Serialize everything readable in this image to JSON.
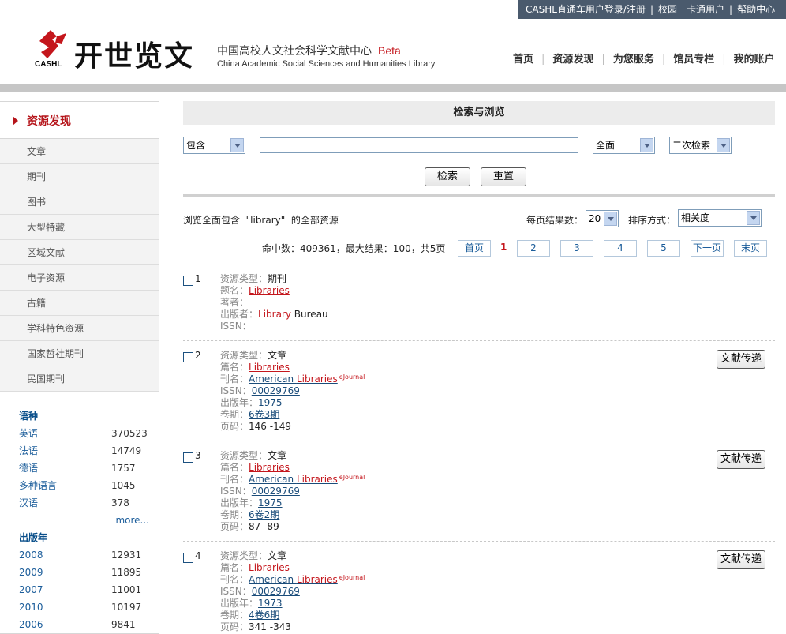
{
  "topbar": {
    "login": "CASHL直通车用户登录/注册",
    "campus": "校园一卡通用户",
    "help": "帮助中心"
  },
  "header": {
    "logo_text": "开世览文",
    "logo_sub": "CASHL",
    "org_cn": "中国高校人文社会科学文献中心",
    "beta": "Beta",
    "org_en": "China Academic Social Sciences and Humanities Library",
    "nav": [
      "首页",
      "资源发现",
      "为您服务",
      "馆员专栏",
      "我的账户"
    ]
  },
  "sidebar": {
    "title": "资源发现",
    "items": [
      "文章",
      "期刊",
      "图书",
      "大型特藏",
      "区域文献",
      "电子资源",
      "古籍",
      "学科特色资源",
      "国家哲社期刊",
      "民国期刊"
    ],
    "language": {
      "title": "语种",
      "rows": [
        {
          "label": "英语",
          "count": "370523"
        },
        {
          "label": "法语",
          "count": "14749"
        },
        {
          "label": "德语",
          "count": "1757"
        },
        {
          "label": "多种语言",
          "count": "1045"
        },
        {
          "label": "汉语",
          "count": "378"
        }
      ],
      "more": "more..."
    },
    "year": {
      "title": "出版年",
      "rows": [
        {
          "label": "2008",
          "count": "12931"
        },
        {
          "label": "2009",
          "count": "11895"
        },
        {
          "label": "2007",
          "count": "11001"
        },
        {
          "label": "2010",
          "count": "10197"
        },
        {
          "label": "2006",
          "count": "9841"
        }
      ]
    }
  },
  "search": {
    "title": "检索与浏览",
    "match_select": "包含",
    "query_value": "",
    "scope_select": "全面",
    "mode_select": "二次检索",
    "search_button": "检索",
    "reset_button": "重置"
  },
  "listing": {
    "browse_info": "浏览全面包含  \"library\"  的全部资源",
    "perpage_label": "每页结果数：",
    "perpage_value": "20",
    "sort_label": "排序方式：",
    "sort_value": "相关度",
    "hits": "命中数：409361，最大结果：100，共5页",
    "pager": {
      "first": "首页",
      "current": "1",
      "pages": [
        "2",
        "3",
        "4",
        "5"
      ],
      "next": "下一页",
      "last": "末页"
    }
  },
  "results": [
    {
      "num": "1",
      "type_label": "资源类型：",
      "type": "期刊",
      "title_label": "题名：",
      "title": "Libraries",
      "author_label": "著者：",
      "publisher_label": "出版者：",
      "publisher_hl": "Library",
      "publisher_rest": " Bureau",
      "issn_label": "ISSN："
    },
    {
      "num": "2",
      "type_label": "资源类型：",
      "type": "文章",
      "title_label": "篇名：",
      "title": "Libraries",
      "journal_label": "刊名：",
      "journal_a": "American ",
      "journal_b": "Libraries",
      "ejournal": "eJournal",
      "issn_label": "ISSN：",
      "issn": "00029769",
      "year_label": "出版年：",
      "year": "1975",
      "vol_label": "卷期：",
      "vol": "6卷3期",
      "pages_label": "页码：",
      "pages": "146 -149",
      "deliver": "文献传递"
    },
    {
      "num": "3",
      "type_label": "资源类型：",
      "type": "文章",
      "title_label": "篇名：",
      "title": "Libraries",
      "journal_label": "刊名：",
      "journal_a": "American ",
      "journal_b": "Libraries",
      "ejournal": "eJournal",
      "issn_label": "ISSN：",
      "issn": "00029769",
      "year_label": "出版年：",
      "year": "1975",
      "vol_label": "卷期：",
      "vol": "6卷2期",
      "pages_label": "页码：",
      "pages": "87 -89",
      "deliver": "文献传递"
    },
    {
      "num": "4",
      "type_label": "资源类型：",
      "type": "文章",
      "title_label": "篇名：",
      "title": "Libraries",
      "journal_label": "刊名：",
      "journal_a": "American ",
      "journal_b": "Libraries",
      "ejournal": "eJournal",
      "issn_label": "ISSN：",
      "issn": "00029769",
      "year_label": "出版年：",
      "year": "1973",
      "vol_label": "卷期：",
      "vol": "4卷6期",
      "pages_label": "页码：",
      "pages": "341 -343",
      "deliver": "文献传递"
    }
  ]
}
